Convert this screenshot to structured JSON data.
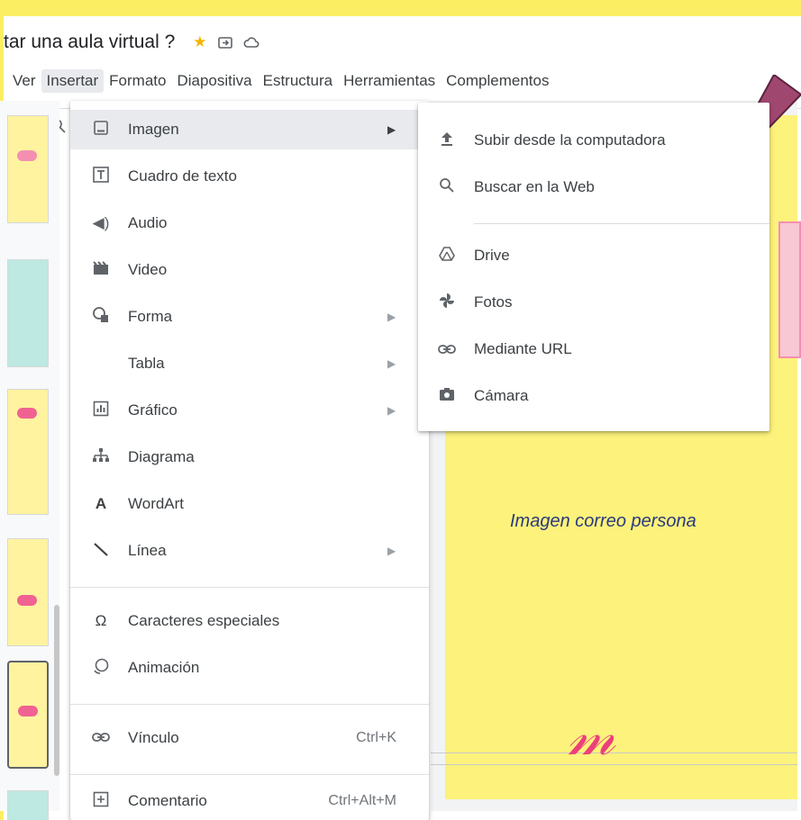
{
  "document": {
    "title": "tar una aula virtual ?",
    "icons": [
      "star-icon",
      "move-to-folder-icon",
      "cloud-status-icon"
    ]
  },
  "menubar": {
    "items": [
      {
        "label": "Ver"
      },
      {
        "label": "Insertar"
      },
      {
        "label": "Formato"
      },
      {
        "label": "Diapositiva"
      },
      {
        "label": "Estructura"
      },
      {
        "label": "Herramientas"
      },
      {
        "label": "Complementos"
      }
    ]
  },
  "insert_menu": {
    "items": [
      {
        "label": "Imagen",
        "icon": "image-icon"
      },
      {
        "label": "Cuadro de texto",
        "icon": "text-box-icon"
      },
      {
        "label": "Audio",
        "icon": "audio-icon"
      },
      {
        "label": "Video",
        "icon": "video-icon"
      },
      {
        "label": "Forma",
        "icon": "shape-icon"
      },
      {
        "label": "Tabla",
        "icon": ""
      },
      {
        "label": "Gráfico",
        "icon": "chart-icon"
      },
      {
        "label": "Diagrama",
        "icon": "diagram-icon"
      },
      {
        "label": "WordArt",
        "icon": "wordart-icon"
      },
      {
        "label": "Línea",
        "icon": "line-icon"
      },
      {
        "label": "Caracteres especiales",
        "icon": "omega-icon"
      },
      {
        "label": "Animación",
        "icon": "animation-icon"
      },
      {
        "label": "Vínculo",
        "icon": "link-icon",
        "shortcut": "Ctrl+K"
      },
      {
        "label": "Comentario",
        "icon": "comment-icon",
        "shortcut": "Ctrl+Alt+M"
      }
    ]
  },
  "image_submenu": {
    "items": [
      {
        "label": "Subir desde la computadora",
        "icon": "upload-icon"
      },
      {
        "label": "Buscar en la Web",
        "icon": "search-icon"
      },
      {
        "label": "Drive",
        "icon": "drive-icon"
      },
      {
        "label": "Fotos",
        "icon": "photos-icon"
      },
      {
        "label": "Mediante URL",
        "icon": "link-icon"
      },
      {
        "label": "Cámara",
        "icon": "camera-icon"
      }
    ]
  },
  "slide": {
    "caption": "Imagen correo persona"
  },
  "colors": {
    "page_background": "#fbee63",
    "slide_background": "#fcf27c",
    "arrow": "#a0476f",
    "caption": "#2a3a7c",
    "menu_hover": "#e8eaed"
  }
}
